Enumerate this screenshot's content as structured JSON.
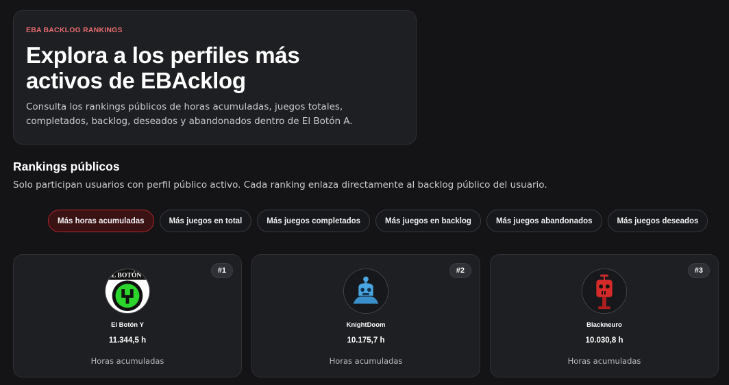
{
  "hero": {
    "eyebrow": "EBA BACKLOG RANKINGS",
    "title": "Explora a los perfiles más activos de EBAcklog",
    "description": "Consulta los rankings públicos de horas acumuladas, juegos totales, completados, backlog, deseados y abandonados dentro de El Botón A."
  },
  "rankings": {
    "title": "Rankings públicos",
    "description": "Solo participan usuarios con perfil público activo. Cada ranking enlaza directamente al backlog público del usuario.",
    "tabs": [
      {
        "label": "Más horas acumuladas",
        "active": true
      },
      {
        "label": "Más juegos en total",
        "active": false
      },
      {
        "label": "Más juegos completados",
        "active": false
      },
      {
        "label": "Más juegos en backlog",
        "active": false
      },
      {
        "label": "Más juegos abandonados",
        "active": false
      },
      {
        "label": "Más juegos deseados",
        "active": false
      }
    ],
    "cards": [
      {
        "rank": "#1",
        "name": "El Botón Y",
        "value": "11.344,5 h",
        "metric": "Horas acumuladas",
        "avatar_icon": "el-boton-y-logo-icon",
        "avatar_text": "EL BOTÓN Y"
      },
      {
        "rank": "#2",
        "name": "KnightDoom",
        "value": "10.175,7 h",
        "metric": "Horas acumuladas",
        "avatar_icon": "blue-robot-icon"
      },
      {
        "rank": "#3",
        "name": "Blackneuro",
        "value": "10.030,8 h",
        "metric": "Horas acumuladas",
        "avatar_icon": "red-robot-icon"
      }
    ]
  },
  "colors": {
    "accent": "#e56b6f",
    "active_tab_bg": "#3b1214",
    "active_tab_border": "#b3262d",
    "card_bg": "#1e1f23",
    "page_bg": "#141416"
  }
}
